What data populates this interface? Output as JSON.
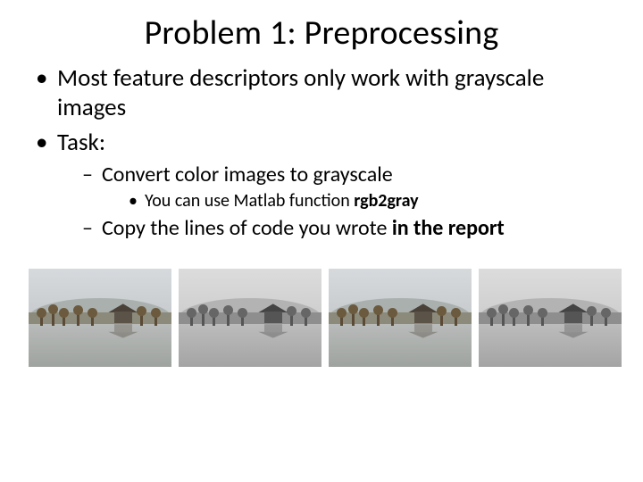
{
  "title": "Problem 1: Preprocessing",
  "bullets": {
    "b1": "Most feature descriptors only work with grayscale images",
    "b2": "Task:",
    "b2a": "Convert color images to grayscale",
    "b2a1_pre": "You can use Matlab function ",
    "b2a1_bold": "rgb2gray",
    "b2b_pre": "Copy the lines of code you wrote ",
    "b2b_bold": "in the report"
  },
  "images": [
    {
      "variant": "color",
      "alt": "color landscape with pavilion by water"
    },
    {
      "variant": "gray",
      "alt": "grayscale landscape with pavilion by water"
    },
    {
      "variant": "color",
      "alt": "color landscape with pavilion by water"
    },
    {
      "variant": "gray",
      "alt": "grayscale landscape with pavilion by water"
    }
  ]
}
